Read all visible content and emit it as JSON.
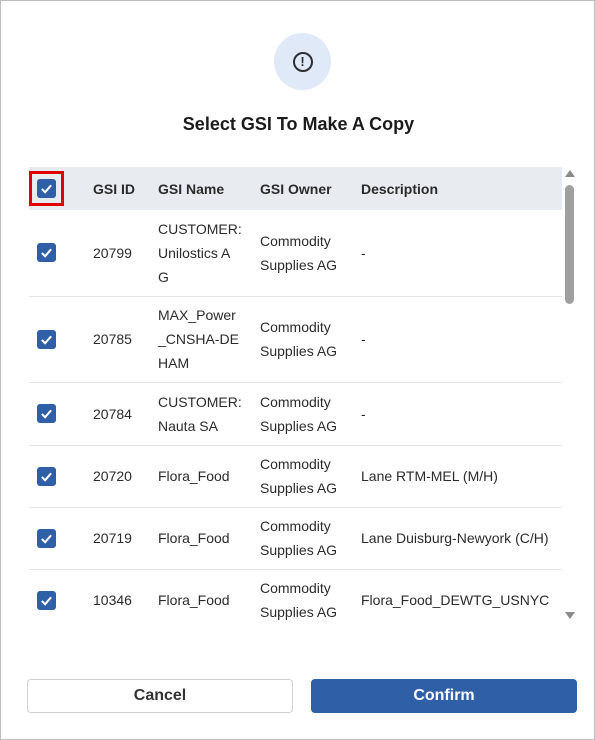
{
  "dialog": {
    "title": "Select GSI To Make A Copy",
    "icon": "alert-circle-icon",
    "accent_color": "#2f5fa6"
  },
  "table": {
    "headers": {
      "id": "GSI ID",
      "name": "GSI Name",
      "owner": "GSI Owner",
      "description": "Description"
    },
    "select_all_checked": true,
    "rows": [
      {
        "checked": true,
        "id": "20799",
        "name": [
          "CUSTOMER:",
          "Unilostics A",
          "G"
        ],
        "owner": [
          "Commodity",
          "Supplies AG"
        ],
        "description": "-"
      },
      {
        "checked": true,
        "id": "20785",
        "name": [
          "MAX_Power",
          "_CNSHA-DE",
          "HAM"
        ],
        "owner": [
          "Commodity",
          "Supplies AG"
        ],
        "description": "-"
      },
      {
        "checked": true,
        "id": "20784",
        "name": [
          "CUSTOMER:",
          "Nauta SA"
        ],
        "owner": [
          "Commodity",
          "Supplies AG"
        ],
        "description": "-"
      },
      {
        "checked": true,
        "id": "20720",
        "name": [
          "Flora_Food"
        ],
        "owner": [
          "Commodity",
          "Supplies AG"
        ],
        "description": "Lane RTM-MEL (M/H)"
      },
      {
        "checked": true,
        "id": "20719",
        "name": [
          "Flora_Food"
        ],
        "owner": [
          "Commodity",
          "Supplies AG"
        ],
        "description": "Lane Duisburg-Newyork (C/H)"
      },
      {
        "checked": true,
        "id": "10346",
        "name": [
          "Flora_Food"
        ],
        "owner": [
          "Commodity",
          "Supplies AG"
        ],
        "description": "Flora_Food_DEWTG_USNYC"
      }
    ]
  },
  "buttons": {
    "cancel_label": "Cancel",
    "confirm_label": "Confirm"
  }
}
